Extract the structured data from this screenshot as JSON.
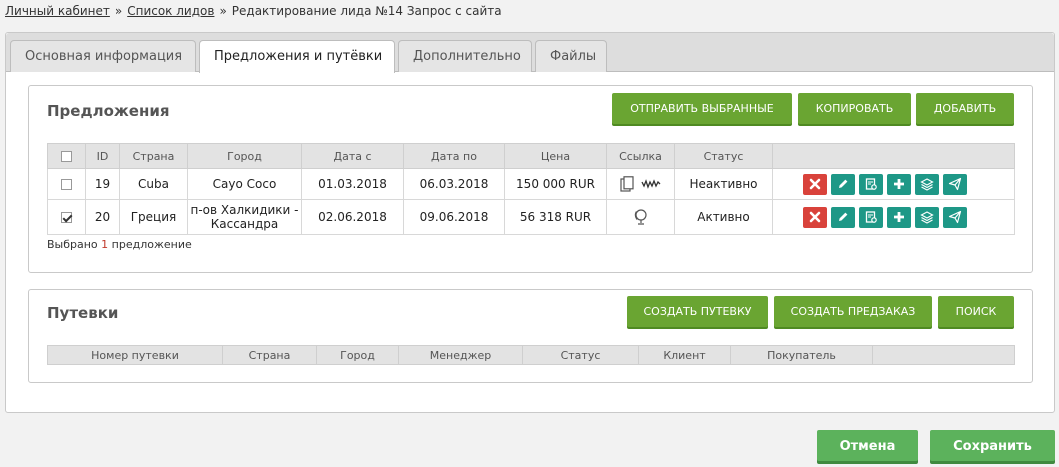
{
  "breadcrumb": {
    "items": [
      "Личный кабинет",
      "Список лидов"
    ],
    "separator": "»",
    "current": "Редактирование лида №14 Запрос с сайта"
  },
  "tabs": [
    {
      "label": "Основная информация",
      "active": false
    },
    {
      "label": "Предложения и путёвки",
      "active": true
    },
    {
      "label": "Дополнительно",
      "active": false
    },
    {
      "label": "Файлы",
      "active": false
    }
  ],
  "offers": {
    "title": "Предложения",
    "buttons": {
      "send": "ОТПРАВИТЬ ВЫБРАННЫЕ",
      "copy": "КОПИРОВАТЬ",
      "add": "ДОБАВИТЬ"
    },
    "columns": [
      "ID",
      "Страна",
      "Город",
      "Дата с",
      "Дата по",
      "Цена",
      "Ссылка",
      "Статус"
    ],
    "rows": [
      {
        "checked": false,
        "id": "19",
        "country": "Cuba",
        "city": "Cayo Coco",
        "date_from": "01.03.2018",
        "date_to": "06.03.2018",
        "price": "150 000 RUR",
        "status": "Неактивно"
      },
      {
        "checked": true,
        "id": "20",
        "country": "Греция",
        "city": "п-ов Халкидики - Кассандра",
        "date_from": "02.06.2018",
        "date_to": "09.06.2018",
        "price": "56 318 RUR",
        "status": "Активно"
      }
    ],
    "selected": {
      "prefix": "Выбрано",
      "count": "1",
      "suffix": "предложение"
    }
  },
  "vouchers": {
    "title": "Путевки",
    "buttons": {
      "create": "СОЗДАТЬ ПУТЕВКУ",
      "preorder": "СОЗДАТЬ ПРЕДЗАКАЗ",
      "search": "ПОИСК"
    },
    "columns": [
      "Номер путевки",
      "Страна",
      "Город",
      "Менеджер",
      "Статус",
      "Клиент",
      "Покупатель"
    ]
  },
  "footer": {
    "cancel": "Отмена",
    "save": "Сохранить"
  },
  "colors": {
    "green_button": "#6aa532",
    "danger": "#d9423b",
    "teal": "#1e9887",
    "footer_green": "#5cb25c"
  }
}
